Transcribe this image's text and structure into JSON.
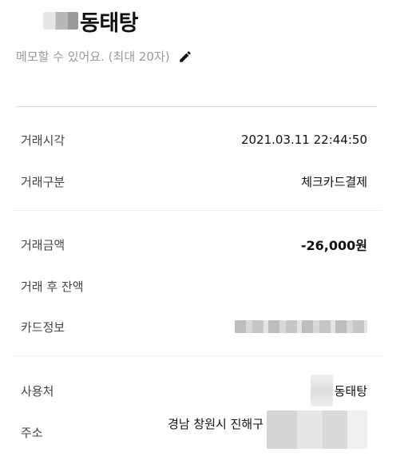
{
  "header": {
    "title": "동태탕",
    "memo_placeholder": "메모할 수 있어요. (최대 20자)"
  },
  "details": {
    "time_label": "거래시각",
    "time_value": "2021.03.11 22:44:50",
    "type_label": "거래구분",
    "type_value": "체크카드결제",
    "amount_label": "거래금액",
    "amount_value": "-26,000원",
    "balance_label": "거래 후 잔액",
    "balance_value": "",
    "card_label": "카드정보",
    "merchant_label": "사용처",
    "merchant_value": "동태탕",
    "address_label": "주소",
    "address_value": "경남 창원시 진해구"
  },
  "icons": {
    "edit": "pencil-icon"
  }
}
